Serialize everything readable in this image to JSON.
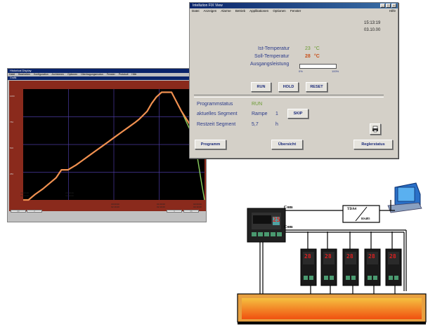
{
  "historical_window": {
    "title": "Historical Display",
    "menu": [
      "Datei",
      "Bearbeiten",
      "Konfiguration",
      "Archivieren",
      "Optionen",
      "Übertragungsmodus",
      "Fenster",
      "Protokoll",
      "Hilfe"
    ],
    "subtitle": "Grafik",
    "y_labels": [
      "1000",
      "750",
      "500",
      "250"
    ],
    "x_ticks": [
      {
        "time": "22:00:49",
        "date": "01.10.00"
      },
      {
        "time": "23:10:49",
        "date": "02.10.00"
      },
      {
        "time": "00:00:00",
        "date": "02.10.00"
      },
      {
        "time": "01:00:00",
        "date": "02.10.00"
      },
      {
        "time": "02:00:00",
        "date": "02.10.00"
      }
    ],
    "buttons_left": [
      "<<",
      "<"
    ],
    "buttons_right": [
      ">",
      ">>"
    ]
  },
  "chart_data": {
    "type": "line",
    "x": [
      0,
      8,
      18,
      30,
      50,
      58,
      68,
      80,
      90,
      100,
      110,
      120,
      130,
      140,
      150,
      160,
      170,
      176,
      188,
      195,
      202,
      210,
      225,
      240,
      260,
      265,
      270,
      275
    ],
    "series": [
      {
        "values": [
          0,
          0,
          35,
          70,
          140,
          190,
          190,
          220,
          250,
          280,
          310,
          340,
          370,
          400,
          430,
          460,
          490,
          510,
          560,
          610,
          650,
          680,
          680,
          560,
          430,
          400,
          380,
          360
        ],
        "color": "#f09050"
      },
      {
        "values": [
          null,
          null,
          null,
          null,
          null,
          null,
          null,
          null,
          null,
          null,
          null,
          null,
          null,
          null,
          null,
          null,
          null,
          null,
          null,
          null,
          null,
          680,
          680,
          560,
          380,
          250,
          120,
          0
        ],
        "color": "#8cd060"
      }
    ],
    "ylim": [
      0,
      700
    ],
    "grid": true,
    "background": "#000000"
  },
  "fdi_window": {
    "title": "Intellution FIX View",
    "menu": [
      "Datei",
      "Anzeigen",
      "Alarme",
      "Betrieb",
      "Applikationen",
      "Optionen",
      "Fenster"
    ],
    "help": "Hilfe",
    "time": "15:13:19",
    "date": "03.10.00",
    "ist_label": "Ist-Temperatur",
    "ist_value": "23",
    "ist_unit": "°C",
    "soll_label": "Soll-Temperatur",
    "soll_value": "28",
    "soll_unit": "°C",
    "output_label": "Ausgangsleistung",
    "output_min": "0%",
    "output_max": "100%",
    "output_fraction": 0.0,
    "btn_run": "RUN",
    "btn_hold": "HOLD",
    "btn_reset": "RESET",
    "programmstatus_label": "Programmstatus",
    "programmstatus_value": "RUN",
    "segment_label": "aktuelles Segment",
    "segment_type": "Rampe",
    "segment_number": "1",
    "btn_skip": "SKIP",
    "restzeit_label": "Restzeit Segment",
    "restzeit_value": "5,7",
    "restzeit_unit": "h",
    "btn_programm": "Programm",
    "btn_uebersicht": "Übersicht",
    "btn_reglerstatus": "Reglerstatus"
  },
  "diagram": {
    "com_top": "Com",
    "com_bottom": "Com",
    "converter_line1": "TDA4",
    "converter_line2": "RS485",
    "master_display": "25",
    "slave_display": "28",
    "colors": {
      "furnace_outer": "#e8a040",
      "furnace_inner": "#f06010",
      "display": "#e02020",
      "controller": "#1a1a1a"
    }
  }
}
